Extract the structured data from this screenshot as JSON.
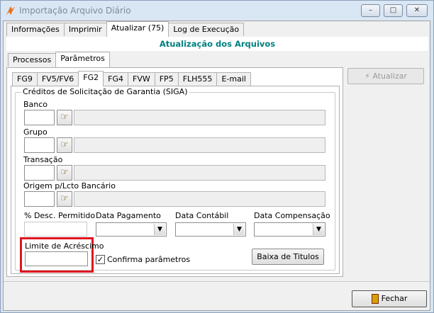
{
  "window": {
    "title": "Importação Arquivo Diário",
    "controls": {
      "minimize": "–",
      "maximize": "□",
      "close": "✕"
    }
  },
  "main_tabs": [
    "Informações",
    "Imprimir",
    "Atualizar (75)",
    "Log de Execução"
  ],
  "header": {
    "title": "Atualização dos Arquivos"
  },
  "sub_tabs": [
    "Processos",
    "Parâmetros"
  ],
  "file_tabs": [
    "FG9",
    "FV5/FV6",
    "FG2",
    "FG4",
    "FVW",
    "FP5",
    "FLH555",
    "E-mail"
  ],
  "actions": {
    "atualizar_label": "Atualizar",
    "fechar_label": "Fechar"
  },
  "group": {
    "title": "Créditos de Solicitação de Garantia (SIGA)",
    "fields": [
      {
        "label": "Banco",
        "value": ""
      },
      {
        "label": "Grupo",
        "value": ""
      },
      {
        "label": "Transação",
        "value": ""
      },
      {
        "label": "Origem p/Lcto Bancário",
        "value": ""
      }
    ],
    "desc_label": "% Desc. Permitido",
    "data_pagamento_label": "Data Pagamento",
    "data_contabil_label": "Data Contábil",
    "data_compensacao_label": "Data Compensação",
    "limite_label": "Limite de Acréscimo",
    "confirma_label": "Confirma parâmetros",
    "confirma_checked": true,
    "baixa_label": "Baixa de Titulos"
  },
  "icons": {
    "lookup": "☞",
    "check": "✓",
    "dropdown": "▼"
  },
  "colors": {
    "header_text": "#008080",
    "highlight": "#e0141e"
  }
}
